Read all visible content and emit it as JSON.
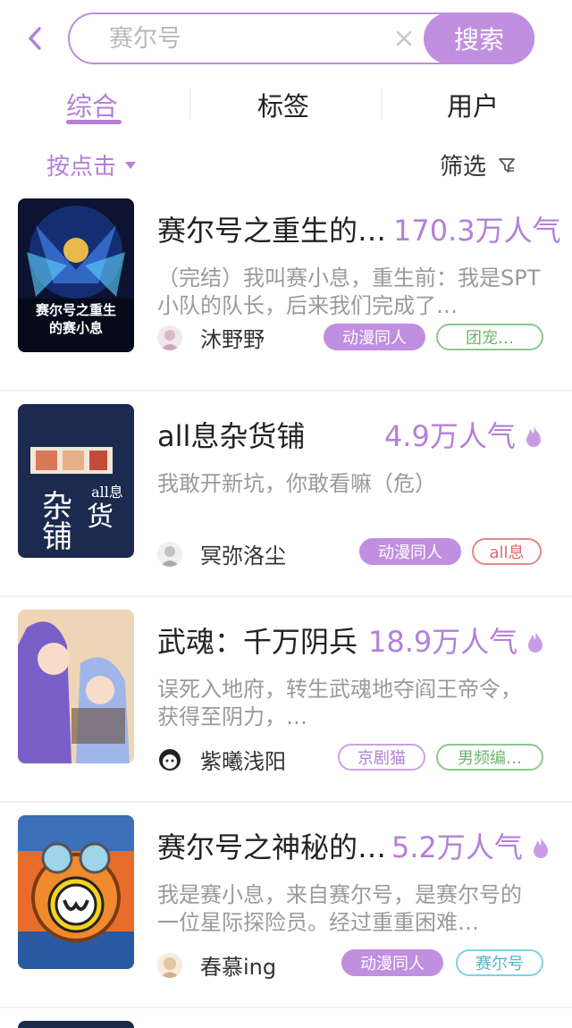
{
  "search": {
    "query": "赛尔号",
    "button_label": "搜索"
  },
  "tabs": [
    {
      "label": "综合",
      "active": true
    },
    {
      "label": "标签",
      "active": false
    },
    {
      "label": "用户",
      "active": false
    }
  ],
  "sort": {
    "label": "按点击"
  },
  "filter": {
    "label": "筛选"
  },
  "colors": {
    "accent": "#b57fd9",
    "button": "#c08fe0"
  },
  "items": [
    {
      "title": "赛尔号之重生的…",
      "popularity": "170.3万人气",
      "hot": false,
      "desc": "（完结）我叫赛小息，重生前：我是SPT小队的队长，后来我们完成了…",
      "author": "沐野野",
      "tags": [
        "动漫同人",
        "团宠…"
      ],
      "cover_text": [
        "赛尔号之重生",
        "的赛小息"
      ]
    },
    {
      "title": "all息杂货铺",
      "popularity": "4.9万人气",
      "hot": true,
      "desc": "我敢开新坑，你敢看嘛（危）",
      "author": "冥弥洛尘",
      "tags": [
        "动漫同人",
        "all息"
      ],
      "cover_text": [
        "杂",
        "货",
        "铺",
        "all息"
      ]
    },
    {
      "title": "武魂：千万阴兵",
      "popularity": "18.9万人气",
      "hot": true,
      "desc": "误死入地府，转生武魂地夺阎王帝令，获得至阴力，…",
      "author": "紫曦浅阳",
      "tags": [
        "京剧猫",
        "男频编…"
      ]
    },
    {
      "title": "赛尔号之神秘的…",
      "popularity": "5.2万人气",
      "hot": true,
      "desc": "我是赛小息，来自赛尔号，是赛尔号的一位星际探险员。经过重重困难…",
      "author": "春慕ing",
      "tags": [
        "动漫同人",
        "赛尔号"
      ]
    }
  ]
}
